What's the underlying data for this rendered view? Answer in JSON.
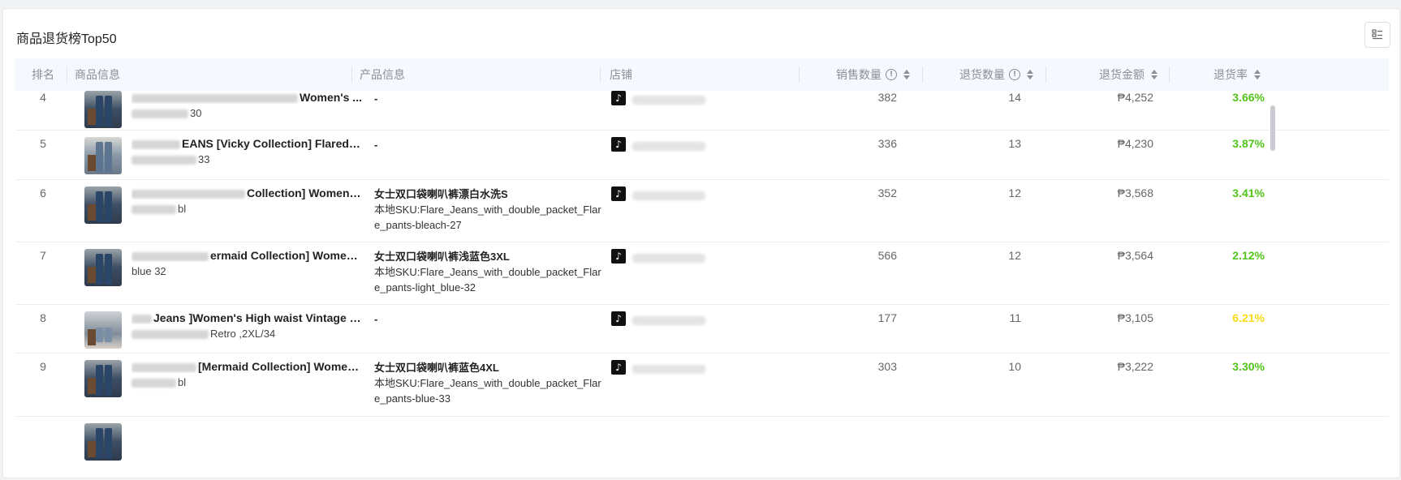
{
  "page": {
    "title": "商品退货榜Top50"
  },
  "columns": {
    "rank": "排名",
    "product_info": "商品信息",
    "sku_info": "产品信息",
    "shop": "店铺",
    "sales_qty": "销售数量",
    "return_qty": "退货数量",
    "return_amount": "退货金额",
    "return_rate": "退货率"
  },
  "icons": {
    "settings": "column-settings-icon",
    "info": "info-circle-icon",
    "sort": "sort-caret-icon",
    "shop_platform": "tiktok-icon"
  },
  "colors": {
    "rate_green": "#52c41a",
    "rate_yellow": "#fadb14",
    "header_bg": "#f5f8fc"
  },
  "rows": [
    {
      "rank": "4",
      "name": "Women's ...",
      "variant": "30",
      "sku_title": "-",
      "sku_line1": "",
      "sku_line2": "",
      "sales": "382",
      "returns": "14",
      "amount": "₱4,252",
      "rate": "3.66%",
      "rate_color": "green"
    },
    {
      "rank": "5",
      "name": "EANS [Vicky Collection] Flared Pants ...",
      "variant": "33",
      "sku_title": "-",
      "sku_line1": "",
      "sku_line2": "",
      "sales": "336",
      "returns": "13",
      "amount": "₱4,230",
      "rate": "3.87%",
      "rate_color": "green"
    },
    {
      "rank": "6",
      "name": "Collection] Women's ...",
      "variant": "bl",
      "sku_title": "女士双口袋喇叭裤漂白水洗S",
      "sku_line1": "本地SKU:Flare_Jeans_with_double_packet_Flare_pa",
      "sku_line2": "nts-bleach-27",
      "sales": "352",
      "returns": "12",
      "amount": "₱3,568",
      "rate": "3.41%",
      "rate_color": "green"
    },
    {
      "rank": "7",
      "name": "ermaid Collection] Women's ...",
      "variant": "blue 32",
      "sku_title": "女士双口袋喇叭裤浅蓝色3XL",
      "sku_line1": "本地SKU:Flare_Jeans_with_double_packet_Flare_pa",
      "sku_line2": "nts-light_blue-32",
      "sales": "566",
      "returns": "12",
      "amount": "₱3,564",
      "rate": "2.12%",
      "rate_color": "green"
    },
    {
      "rank": "8",
      "name": "Jeans ]Women's High waist Vintage W...",
      "variant": "Retro ,2XL/34",
      "sku_title": "-",
      "sku_line1": "",
      "sku_line2": "",
      "sales": "177",
      "returns": "11",
      "amount": "₱3,105",
      "rate": "6.21%",
      "rate_color": "yellow"
    },
    {
      "rank": "9",
      "name": "[Mermaid Collection] Women's ...",
      "variant": "bl",
      "sku_title": "女士双口袋喇叭裤蓝色4XL",
      "sku_line1": "本地SKU:Flare_Jeans_with_double_packet_Flare_pa",
      "sku_line2": "nts-blue-33",
      "sales": "303",
      "returns": "10",
      "amount": "₱3,222",
      "rate": "3.30%",
      "rate_color": "green"
    }
  ]
}
